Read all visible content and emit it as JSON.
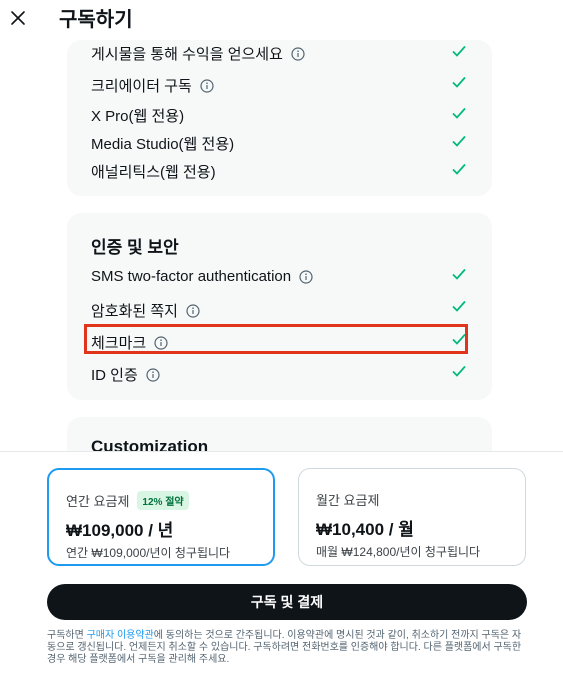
{
  "header": {
    "title": "구독하기",
    "close_icon": "close-icon"
  },
  "card1": {
    "items": [
      {
        "label": "게시물을 통해 수익을 얻으세요",
        "info": true
      },
      {
        "label": "크리에이터 구독",
        "info": true
      },
      {
        "label": "X Pro(웹 전용)",
        "info": false
      },
      {
        "label": "Media Studio(웹 전용)",
        "info": false
      },
      {
        "label": "애널리틱스(웹 전용)",
        "info": false
      }
    ]
  },
  "card2": {
    "title": "인증 및 보안",
    "items": [
      {
        "label": "SMS two-factor authentication",
        "info": true
      },
      {
        "label": "암호화된 쪽지",
        "info": true
      },
      {
        "label": "체크마크",
        "info": true,
        "highlighted": true
      },
      {
        "label": "ID 인증",
        "info": true
      }
    ]
  },
  "card3": {
    "title": "Customization"
  },
  "plans": {
    "annual": {
      "title": "연간 요금제",
      "badge": "12% 절약",
      "price": "₩109,000 / 년",
      "sub": "연간 ₩109,000/년이 청구됩니다",
      "selected": true
    },
    "monthly": {
      "title": "월간 요금제",
      "price": "₩10,400 / 월",
      "sub": "매월 ₩124,800/년이 청구됩니다",
      "selected": false
    }
  },
  "cta": {
    "label": "구독 및 결제"
  },
  "legal": {
    "prefix": "구독하면 ",
    "link": "구매자 이용약관",
    "suffix": "에 동의하는 것으로 간주됩니다. 이용약관에 명시된 것과 같이, 취소하기 전까지 구독은 자동으로 갱신됩니다. 언제든지 취소할 수 있습니다. 구독하려면 전화번호를 인증해야 합니다. 다른 플랫폼에서 구독한 경우 해당 플랫폼에서 구독을 관리해 주세요."
  },
  "colors": {
    "accent": "#1d9bf0",
    "check": "#00ba7c",
    "highlight": "#e0351a",
    "dark": "#0f1419"
  }
}
